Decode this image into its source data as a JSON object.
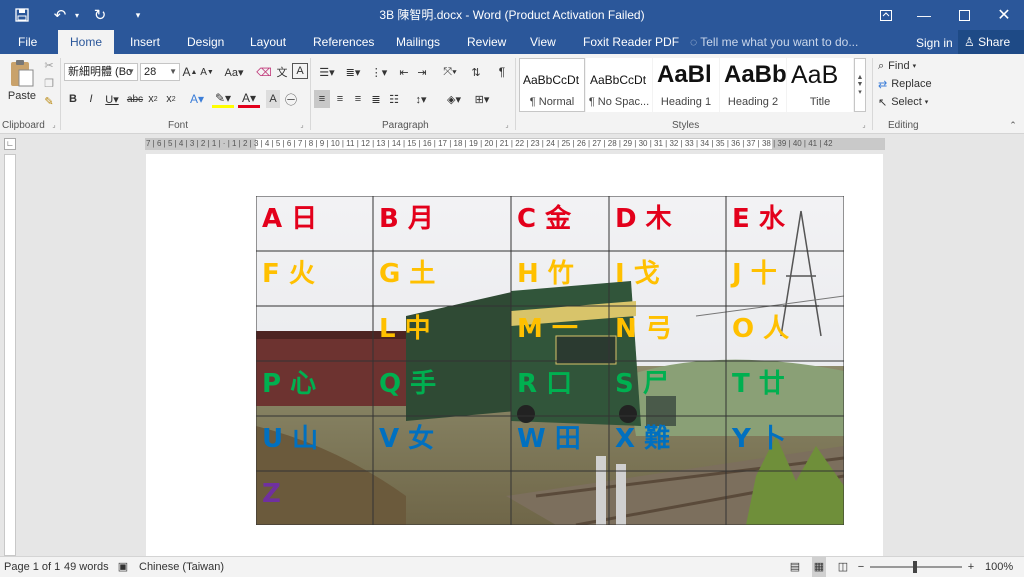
{
  "window": {
    "title": "3B 陳智明.docx - Word (Product Activation Failed)",
    "qat": {
      "save_icon": "save-icon",
      "undo_icon": "undo-icon",
      "redo_icon": "redo-icon",
      "customize_icon": "customize-icon"
    }
  },
  "tabs": [
    {
      "label": "File"
    },
    {
      "label": "Home"
    },
    {
      "label": "Insert"
    },
    {
      "label": "Design"
    },
    {
      "label": "Layout"
    },
    {
      "label": "References"
    },
    {
      "label": "Mailings"
    },
    {
      "label": "Review"
    },
    {
      "label": "View"
    },
    {
      "label": "Foxit Reader PDF"
    }
  ],
  "tellme": "Tell me what you want to do...",
  "signin": "Sign in",
  "share": "Share",
  "ribbon": {
    "clipboard": {
      "paste": "Paste",
      "label": "Clipboard"
    },
    "font": {
      "name": "新細明體 (Bo",
      "size": "28",
      "label": "Font"
    },
    "paragraph": {
      "label": "Paragraph"
    },
    "styles": {
      "label": "Styles",
      "items": [
        {
          "sample": "AaBbCcDt",
          "name": "¶ Normal"
        },
        {
          "sample": "AaBbCcDt",
          "name": "¶ No Spac..."
        },
        {
          "sample": "AaBl",
          "name": "Heading 1"
        },
        {
          "sample": "AaBb",
          "name": "Heading 2"
        },
        {
          "sample": "AaB",
          "name": "Title"
        }
      ]
    },
    "editing": {
      "find": "Find",
      "replace": "Replace",
      "select": "Select",
      "label": "Editing"
    }
  },
  "ruler": "7 | 6 | 5 | 4 | 3 | 2 | 1 | · | 1 | 2 | 3 | 4 | 5 | 6 | 7 | 8 | 9 | 10 | 11 | 12 | 13 | 14 | 15 | 16 | 17 | 18 | 19 | 20 | 21 | 22 | 23 | 24 | 25 | 26 | 27 | 28 | 29 | 30 | 31 | 32 | 33 | 34 | 35 | 36 | 37 | 38 | 39 | 40 | 41 | 42",
  "grid": {
    "cols": [
      0,
      117,
      255,
      353,
      470,
      588
    ],
    "rows": [
      0,
      55,
      110,
      165,
      220,
      275,
      329
    ],
    "colors": {
      "red": "#e3001b",
      "yellow": "#ffc000",
      "green": "#00b050",
      "blue": "#0070c0",
      "purple": "#7030a0"
    },
    "cells": [
      {
        "r": 0,
        "c": 0,
        "text": "A 日",
        "color": "red"
      },
      {
        "r": 0,
        "c": 1,
        "text": "B 月",
        "color": "red"
      },
      {
        "r": 0,
        "c": 2,
        "text": "C 金",
        "color": "red"
      },
      {
        "r": 0,
        "c": 3,
        "text": "D 木",
        "color": "red"
      },
      {
        "r": 0,
        "c": 4,
        "text": "E 水",
        "color": "red"
      },
      {
        "r": 1,
        "c": 0,
        "text": "F 火",
        "color": "yellow"
      },
      {
        "r": 1,
        "c": 1,
        "text": "G 土",
        "color": "yellow"
      },
      {
        "r": 1,
        "c": 2,
        "text": "H 竹",
        "color": "yellow"
      },
      {
        "r": 1,
        "c": 3,
        "text": "I 戈",
        "color": "yellow"
      },
      {
        "r": 1,
        "c": 4,
        "text": "J 十",
        "color": "yellow"
      },
      {
        "r": 2,
        "c": 1,
        "text": "L 中",
        "color": "yellow"
      },
      {
        "r": 2,
        "c": 2,
        "text": "M 一",
        "color": "yellow"
      },
      {
        "r": 2,
        "c": 3,
        "text": "N 弓",
        "color": "yellow"
      },
      {
        "r": 2,
        "c": 4,
        "text": "O 人",
        "color": "yellow"
      },
      {
        "r": 3,
        "c": 0,
        "text": "P 心",
        "color": "green"
      },
      {
        "r": 3,
        "c": 1,
        "text": "Q 手",
        "color": "green"
      },
      {
        "r": 3,
        "c": 2,
        "text": "R 口",
        "color": "green"
      },
      {
        "r": 3,
        "c": 3,
        "text": "S 尸",
        "color": "green"
      },
      {
        "r": 3,
        "c": 4,
        "text": "T 廿",
        "color": "green"
      },
      {
        "r": 4,
        "c": 0,
        "text": "U 山",
        "color": "blue"
      },
      {
        "r": 4,
        "c": 1,
        "text": "V 女",
        "color": "blue"
      },
      {
        "r": 4,
        "c": 2,
        "text": "W 田",
        "color": "blue"
      },
      {
        "r": 4,
        "c": 3,
        "text": "X 難",
        "color": "blue"
      },
      {
        "r": 4,
        "c": 4,
        "text": "Y 卜",
        "color": "blue"
      },
      {
        "r": 5,
        "c": 0,
        "text": "Z",
        "color": "purple"
      }
    ]
  },
  "status": {
    "page": "Page 1 of 1",
    "words": "49 words",
    "language": "Chinese (Taiwan)",
    "zoom": "100%",
    "minus": "−",
    "plus": "+"
  }
}
